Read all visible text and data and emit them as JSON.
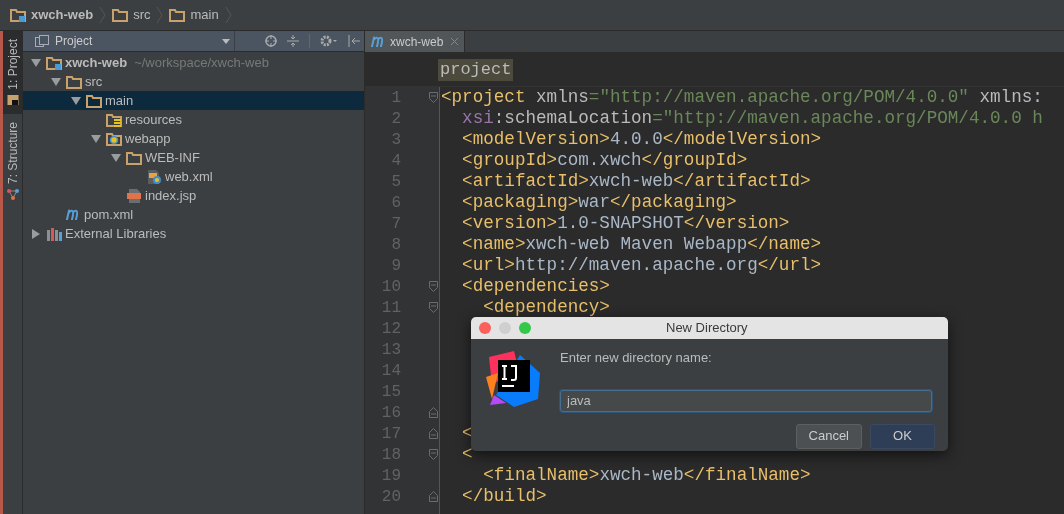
{
  "breadcrumbs": [
    {
      "label": "xwch-web",
      "kind": "module"
    },
    {
      "label": "src",
      "kind": "folder"
    },
    {
      "label": "main",
      "kind": "folder"
    }
  ],
  "tool_tabs": [
    {
      "label": "1: Project",
      "kind": "project",
      "selected": true
    },
    {
      "label": "7: Structure",
      "kind": "structure",
      "selected": false
    }
  ],
  "project_panel": {
    "title": "Project",
    "tree": [
      {
        "label": "xwch-web",
        "path": "~/workspace/xwch-web",
        "kind": "module",
        "expanded": true,
        "selected": false,
        "children": [
          {
            "label": "src",
            "kind": "folder",
            "expanded": true,
            "selected": false,
            "children": [
              {
                "label": "main",
                "kind": "folder",
                "expanded": true,
                "selected": true,
                "children": [
                  {
                    "label": "resources",
                    "kind": "resources",
                    "selected": false
                  },
                  {
                    "label": "webapp",
                    "kind": "web",
                    "expanded": true,
                    "selected": false,
                    "children": [
                      {
                        "label": "WEB-INF",
                        "kind": "folder",
                        "expanded": true,
                        "selected": false,
                        "children": [
                          {
                            "label": "web.xml",
                            "kind": "xml",
                            "selected": false
                          }
                        ]
                      },
                      {
                        "label": "index.jsp",
                        "kind": "jsp",
                        "selected": false
                      }
                    ]
                  }
                ]
              }
            ]
          },
          {
            "label": "pom.xml",
            "kind": "maven",
            "selected": false
          }
        ]
      },
      {
        "label": "External Libraries",
        "kind": "libraries",
        "expanded": false,
        "selected": false
      }
    ]
  },
  "editor": {
    "tabs": [
      {
        "label": "xwch-web",
        "selected": true
      }
    ],
    "breadcrumb": "project",
    "lines": [
      {
        "number": "1",
        "fold_start": true,
        "fold_end": false,
        "tokens": [
          {
            "kind": "tag",
            "text": "<project"
          },
          {
            "kind": "attr",
            "text": " xmlns"
          },
          {
            "kind": "value",
            "text": "=\"http://maven.apache.org/POM/4.0.0\""
          },
          {
            "kind": "attr",
            "text": " xmlns:"
          }
        ]
      },
      {
        "number": "2",
        "fold_start": false,
        "fold_end": false,
        "tokens": [
          {
            "kind": "ns",
            "text": "  xsi"
          },
          {
            "kind": "attr",
            "text": ":schemaLocation"
          },
          {
            "kind": "value",
            "text": "=\"http://maven.apache.org/POM/4.0.0 h"
          }
        ]
      },
      {
        "number": "3",
        "fold_start": false,
        "fold_end": false,
        "tokens": [
          {
            "kind": "tag",
            "text": "  <modelVersion>"
          },
          {
            "kind": "text",
            "text": "4.0.0"
          },
          {
            "kind": "tag",
            "text": "</modelVersion>"
          }
        ]
      },
      {
        "number": "4",
        "fold_start": false,
        "fold_end": false,
        "tokens": [
          {
            "kind": "tag",
            "text": "  <groupId>"
          },
          {
            "kind": "text",
            "text": "com.xwch"
          },
          {
            "kind": "tag",
            "text": "</groupId>"
          }
        ]
      },
      {
        "number": "5",
        "fold_start": false,
        "fold_end": false,
        "tokens": [
          {
            "kind": "tag",
            "text": "  <artifactId>"
          },
          {
            "kind": "text",
            "text": "xwch-web"
          },
          {
            "kind": "tag",
            "text": "</artifactId>"
          }
        ]
      },
      {
        "number": "6",
        "fold_start": false,
        "fold_end": false,
        "tokens": [
          {
            "kind": "tag",
            "text": "  <packaging>"
          },
          {
            "kind": "text",
            "text": "war"
          },
          {
            "kind": "tag",
            "text": "</packaging>"
          }
        ]
      },
      {
        "number": "7",
        "fold_start": false,
        "fold_end": false,
        "tokens": [
          {
            "kind": "tag",
            "text": "  <version>"
          },
          {
            "kind": "text",
            "text": "1.0-SNAPSHOT"
          },
          {
            "kind": "tag",
            "text": "</version>"
          }
        ]
      },
      {
        "number": "8",
        "fold_start": false,
        "fold_end": false,
        "tokens": [
          {
            "kind": "tag",
            "text": "  <name>"
          },
          {
            "kind": "text",
            "text": "xwch-web Maven Webapp"
          },
          {
            "kind": "tag",
            "text": "</name>"
          }
        ]
      },
      {
        "number": "9",
        "fold_start": false,
        "fold_end": false,
        "tokens": [
          {
            "kind": "tag",
            "text": "  <url>"
          },
          {
            "kind": "text",
            "text": "http://maven.apache.org"
          },
          {
            "kind": "tag",
            "text": "</url>"
          }
        ]
      },
      {
        "number": "10",
        "fold_start": true,
        "fold_end": false,
        "tokens": [
          {
            "kind": "tag",
            "text": "  <dependencies>"
          }
        ]
      },
      {
        "number": "11",
        "fold_start": true,
        "fold_end": false,
        "tokens": [
          {
            "kind": "tag",
            "text": "    <dependency>"
          }
        ]
      },
      {
        "number": "12",
        "fold_start": false,
        "fold_end": false
      },
      {
        "number": "13",
        "fold_start": false,
        "fold_end": false
      },
      {
        "number": "14",
        "fold_start": false,
        "fold_end": false
      },
      {
        "number": "15",
        "fold_start": false,
        "fold_end": false
      },
      {
        "number": "16",
        "fold_start": false,
        "fold_end": true
      },
      {
        "number": "17",
        "fold_start": false,
        "fold_end": true,
        "tokens": [
          {
            "kind": "tag",
            "text": "  <"
          }
        ]
      },
      {
        "number": "18",
        "fold_start": true,
        "fold_end": false,
        "tokens": [
          {
            "kind": "tag",
            "text": "  <"
          }
        ]
      },
      {
        "number": "19",
        "fold_start": false,
        "fold_end": false,
        "tokens": [
          {
            "kind": "tag",
            "text": "    <finalName>"
          },
          {
            "kind": "text",
            "text": "xwch-web"
          },
          {
            "kind": "tag",
            "text": "</finalName>"
          }
        ]
      },
      {
        "number": "20",
        "fold_start": false,
        "fold_end": true,
        "tokens": [
          {
            "kind": "tag",
            "text": "  </build>"
          }
        ]
      }
    ]
  },
  "dialog": {
    "title": "New Directory",
    "label": "Enter new directory name:",
    "value": "java",
    "buttons": [
      {
        "label": "Cancel",
        "kind": "secondary"
      },
      {
        "label": "OK",
        "kind": "primary"
      }
    ]
  }
}
